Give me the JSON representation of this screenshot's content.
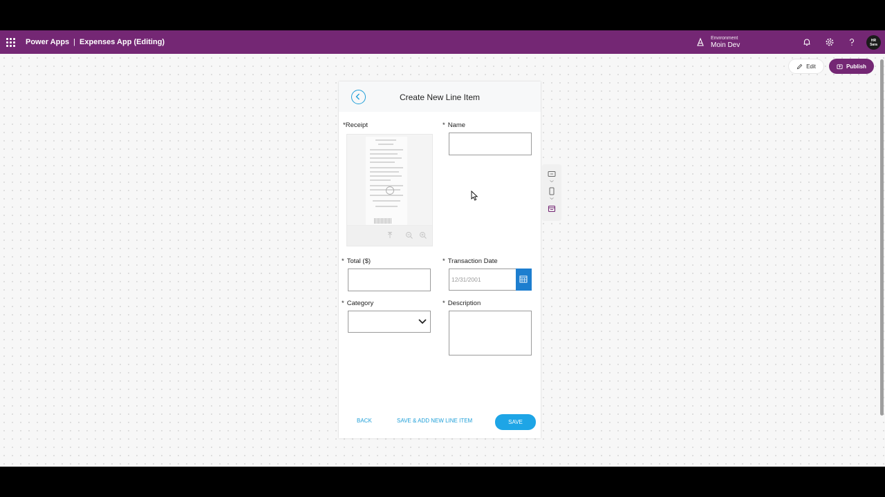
{
  "header": {
    "product": "Power Apps",
    "separator": "|",
    "app_name": "Expenses App (Editing)",
    "environment_label": "Environment",
    "environment_name": "Moin Dev",
    "avatar_line1": "HR",
    "avatar_line2": "Sara",
    "icons": [
      "app-launcher-icon",
      "environment-icon",
      "bell-icon",
      "gear-icon",
      "help-icon"
    ]
  },
  "toolbar": {
    "edit_label": "Edit",
    "publish_label": "Publish"
  },
  "form": {
    "title": "Create New Line Item",
    "required_marker": "*",
    "receipt_label": "Receipt",
    "name_label": "Name",
    "name_value": "",
    "total_label": "Total ($)",
    "total_value": "",
    "date_label": "Transaction Date",
    "date_placeholder": "12/31/2001",
    "category_label": "Category",
    "category_value": "",
    "description_label": "Description",
    "description_value": "",
    "back_label": "BACK",
    "save_add_label": "SAVE & ADD NEW LINE ITEM",
    "save_label": "SAVE"
  },
  "colors": {
    "brand": "#742774",
    "accent": "#1ea5e6",
    "date_button": "#1d7ecf"
  }
}
